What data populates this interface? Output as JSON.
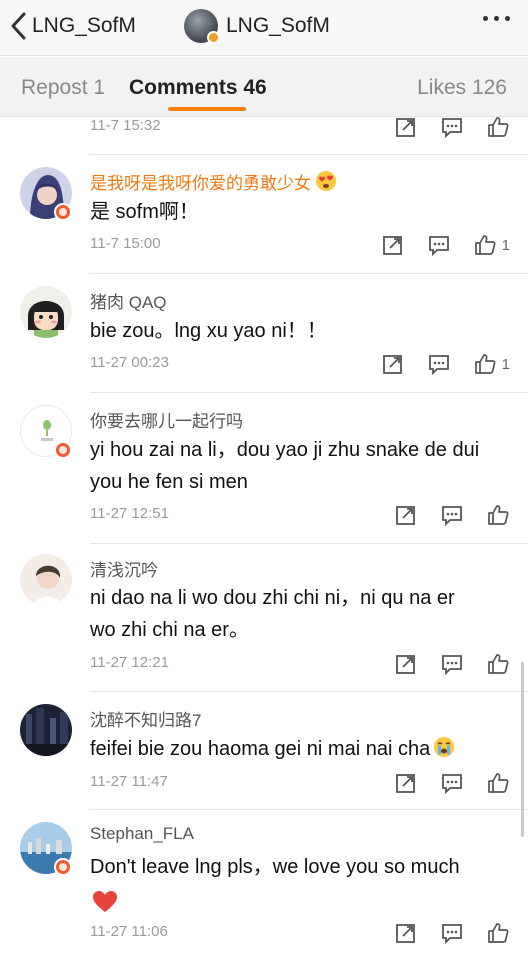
{
  "header": {
    "back_label": "LNG_SofM",
    "title": "LNG_SofM"
  },
  "tabs": [
    {
      "label": "Repost 1"
    },
    {
      "label": "Comments 46"
    },
    {
      "label": "Likes 126"
    }
  ],
  "comments": [
    {
      "time": "11-7 15:32",
      "like_count": ""
    },
    {
      "name": "是我呀是我呀你爱的勇敢少女",
      "text": "是 sofm啊！",
      "time": "11-7 15:00",
      "like_count": "1"
    },
    {
      "name": "猪肉 QAQ",
      "text": "bie zou。lng xu yao ni！！",
      "time": "11-27 00:23",
      "like_count": "1"
    },
    {
      "name": "你要去哪儿一起行吗",
      "text_line1": "yi hou zai na li，dou yao ji zhu snake de dui",
      "text_line2": "you he fen si men",
      "time": "11-27 12:51",
      "like_count": ""
    },
    {
      "name": "清浅沉吟",
      "text_line1": "ni dao na li wo dou zhi chi ni，ni qu na er",
      "text_line2": "wo zhi chi na er。",
      "time": "11-27 12:21",
      "like_count": ""
    },
    {
      "name": "沈醉不知归路7",
      "text": "feifei bie zou haoma gei ni mai nai cha",
      "time": "11-27 11:47",
      "like_count": ""
    },
    {
      "name": "Stephan_FLA",
      "text": "Don't leave lng pls，we love you so much",
      "time": "11-27 11:06",
      "like_count": ""
    }
  ],
  "colors": {
    "accent": "#ff8200",
    "vip_name": "#ef7a12",
    "badge": "#f25a2c"
  }
}
